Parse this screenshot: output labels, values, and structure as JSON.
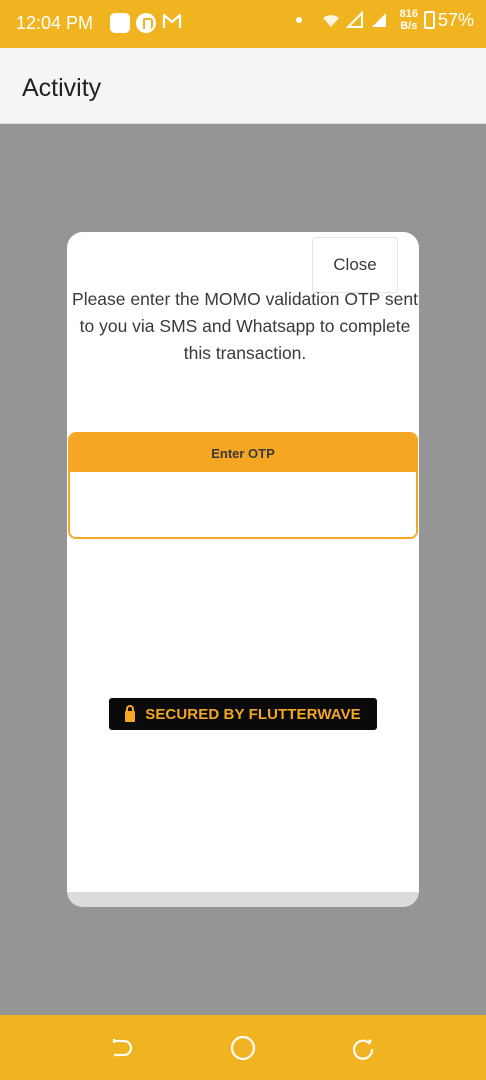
{
  "status_bar": {
    "time": "12:04 PM",
    "net_speed_value": "816",
    "net_speed_unit": "B/s",
    "battery": "57%",
    "icons": [
      "square-app-icon",
      "pinterest-icon",
      "gmail-icon",
      "notification-dot-icon",
      "wifi-icon",
      "signal-icon",
      "signal-icon",
      "battery-icon"
    ]
  },
  "app_bar": {
    "title": "Activity"
  },
  "modal": {
    "close_label": "Close",
    "message": "Please enter the MOMO validation OTP sent to you via SMS and Whatsapp to complete this transaction.",
    "otp_label": "Enter OTP",
    "otp_value": "",
    "secured_text": "SECURED BY FLUTTERWAVE"
  },
  "nav_bar": {
    "icons": [
      "back-icon",
      "home-icon",
      "recent-apps-icon"
    ]
  },
  "colors": {
    "status_bar": "#f0b420",
    "accent": "#f5a623",
    "overlay": "#959595",
    "badge_bg": "#0a0a0a"
  }
}
